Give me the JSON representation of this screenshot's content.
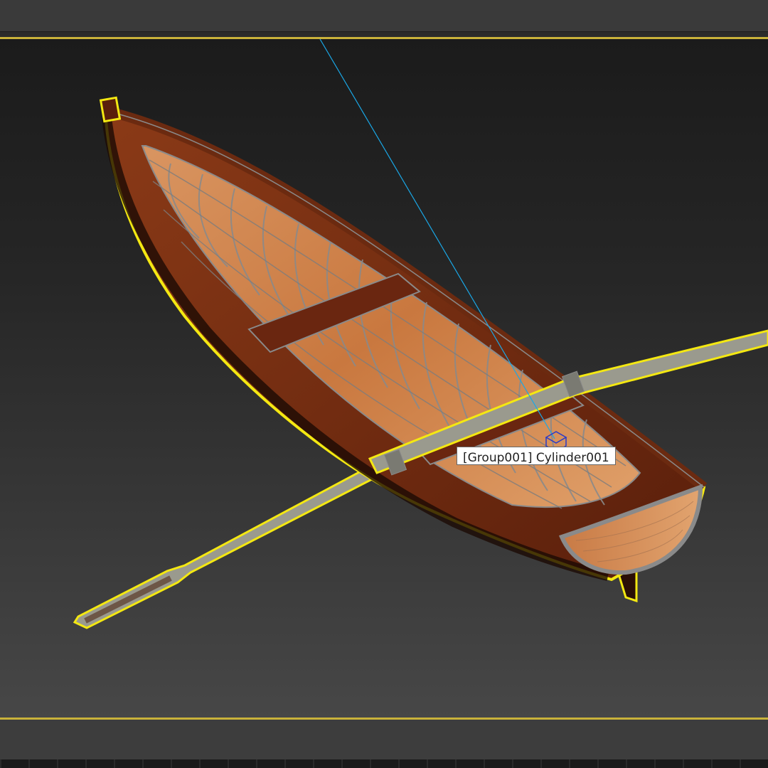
{
  "viewport": {
    "tooltip_text": "[Group001] Cylinder001",
    "selection_color": "#f4e812",
    "pointer_line_color": "#1aa7e6",
    "wood_dark": "#7a2e12",
    "wood_light": "#d98a4a",
    "wire_color": "#8a8a8a",
    "oar_color": "#9a9a8e"
  }
}
